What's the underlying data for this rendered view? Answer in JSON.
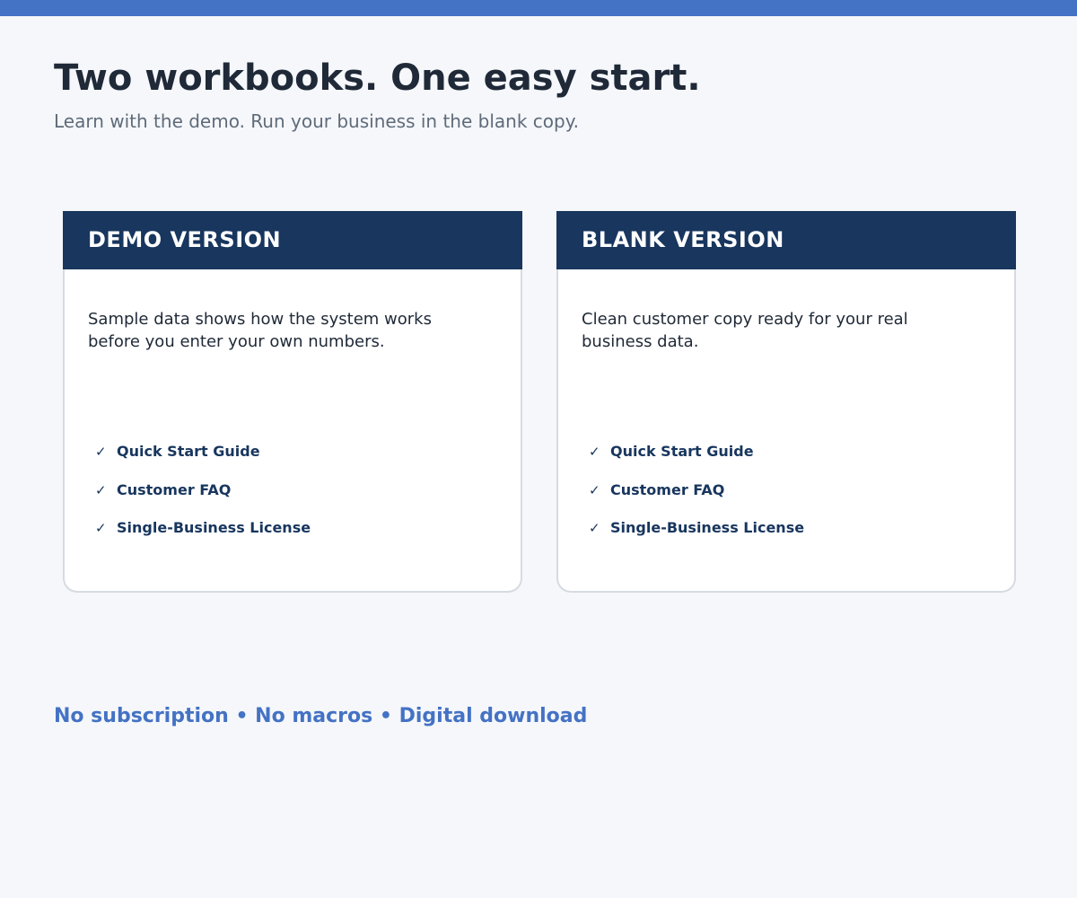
{
  "header": {
    "title": "Two workbooks. One easy start.",
    "subtitle": "Learn with the demo. Run your business in the blank copy."
  },
  "cards": [
    {
      "title": "DEMO VERSION",
      "description": "Sample data shows how the system works before you enter your own numbers.",
      "items": [
        {
          "icon": "check-icon",
          "symbol": "✓",
          "label": "Quick Start Guide"
        },
        {
          "icon": "check-icon",
          "symbol": "✓",
          "label": "Customer FAQ"
        },
        {
          "icon": "check-icon",
          "symbol": "✓",
          "label": "Single-Business License"
        }
      ]
    },
    {
      "title": "BLANK VERSION",
      "description": "Clean customer copy ready for your real business data.",
      "items": [
        {
          "icon": "check-icon",
          "symbol": "✓",
          "label": "Quick Start Guide"
        },
        {
          "icon": "check-icon",
          "symbol": "✓",
          "label": "Customer FAQ"
        },
        {
          "icon": "check-icon",
          "symbol": "✓",
          "label": "Single-Business License"
        }
      ]
    }
  ],
  "footer": {
    "tagline": "No subscription • No macros • Digital download"
  },
  "colors": {
    "accent": "#4472c4",
    "navy": "#18365e",
    "background": "#f5f7fa"
  }
}
